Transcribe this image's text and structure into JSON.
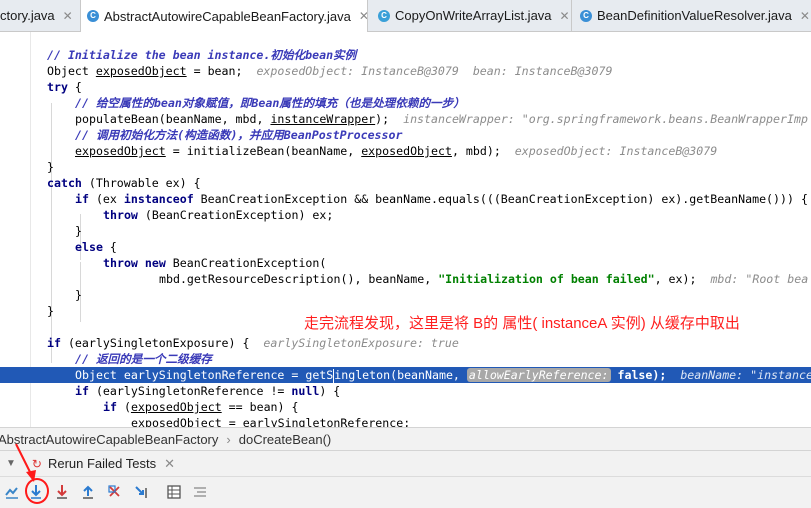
{
  "tabs": [
    {
      "label": "ctory.java",
      "icon": "java-file-icon"
    },
    {
      "label": "AbstractAutowireCapableBeanFactory.java",
      "icon": "class-icon",
      "active": true
    },
    {
      "label": "CopyOnWriteArrayList.java",
      "icon": "class-icon"
    },
    {
      "label": "BeanDefinitionValueResolver.java",
      "icon": "class-icon"
    }
  ],
  "code": {
    "l1": "// Initialize the bean instance.初始化bean实例",
    "l2_a": "Object ",
    "l2_b": "exposedObject",
    "l2_c": " = bean;",
    "l2_hint": "exposedObject: InstanceB@3079  bean: InstanceB@3079",
    "l3": "try",
    "l4": "// 给空属性的bean对象赋值，即Bean属性的填充（也是处理依赖的一步）",
    "l5_a": "populateBean(beanName, mbd, ",
    "l5_b": "instanceWrapper",
    "l5_c": ");",
    "l5_hint": "instanceWrapper: \"org.springframework.beans.BeanWrapperImp",
    "l6": "// 调用初始化方法(构造函数)，并应用BeanPostProcessor",
    "l7_a": "exposedObject",
    "l7_b": " = initializeBean(beanName, ",
    "l7_c": "exposedObject",
    "l7_d": ", mbd);",
    "l7_hint": "exposedObject: InstanceB@3079",
    "l8": "}",
    "l9_a": "catch",
    "l9_b": " (Throwable ex) {",
    "l10_a": "if",
    "l10_b": " (ex ",
    "l10_c": "instanceof",
    "l10_d": " BeanCreationException && beanName.equals(((BeanCreationException) ex).getBeanName())) {",
    "l11_a": "throw",
    "l11_b": " (BeanCreationException) ex;",
    "l12": "}",
    "l13_a": "else",
    "l13_b": " {",
    "l14_a": "throw new",
    "l14_b": " BeanCreationException(",
    "l15_a": "mbd.getResourceDescription(), beanName, ",
    "l15_b": "\"Initialization of bean failed\"",
    "l15_c": ", ex);",
    "l15_hint": "mbd: \"Root bea",
    "l16": "}",
    "l17": "}",
    "l18_a": "if",
    "l18_b": " (earlySingletonExposure) {",
    "l18_hint": "earlySingletonExposure: true",
    "l19": "// 返回的是一个二级缓存",
    "l20_a": "Object earlySingletonReference = getS",
    "l20_b": "ingleton(beanName, ",
    "l20_pill": "allowEarlyReference:",
    "l20_c": " false);",
    "l20_hint": "beanName: \"instanceB\"",
    "l21_a": "if",
    "l21_b": " (earlySingletonReference != ",
    "l21_c": "null",
    "l21_d": ") {",
    "l22_a": "if",
    "l22_b": " (",
    "l22_c": "exposedObject",
    "l22_d": " == bean) {",
    "l23_a": "exposedObject",
    "l23_b": " = earlySingletonReference;"
  },
  "annotation": "走完流程发现，这里是将 B的 属性( instanceA 实例) 从缓存中取出",
  "breadcrumb": {
    "cls": "AbstractAutowireCapableBeanFactory",
    "method": "doCreateBean()"
  },
  "run": {
    "label": "Rerun Failed Tests"
  },
  "colors": {
    "highlight": "#2159b6",
    "annotation": "#ff1f1f",
    "keyword": "#000080"
  }
}
